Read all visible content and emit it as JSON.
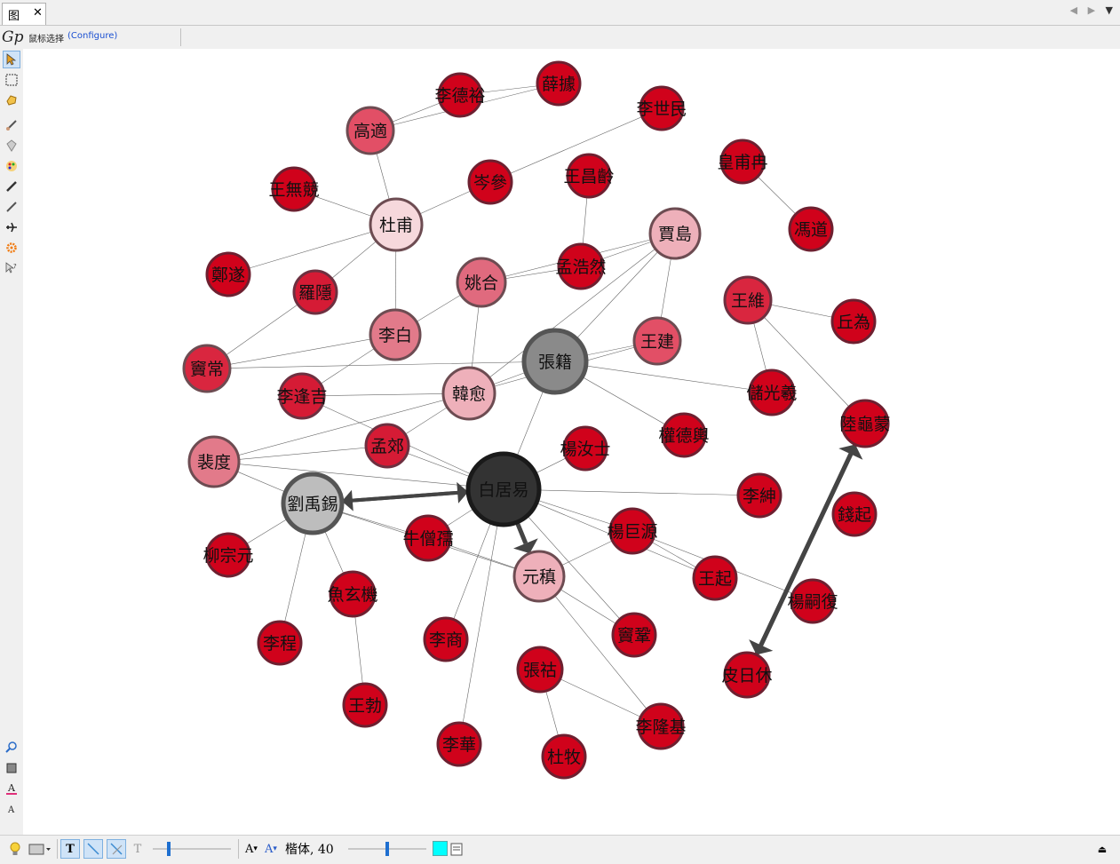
{
  "tab": {
    "label": "图",
    "close": "✕"
  },
  "toolbar": {
    "selection_label": "鼠标选择",
    "configure_link": "(Configure)"
  },
  "bottom": {
    "font_name": "楷体",
    "font_size": "40",
    "font_display": "楷体,  40"
  },
  "colors": {
    "accent_cyan": "#00ffff",
    "node_red": "#d0021b",
    "node_dark": "#333333",
    "node_grey": "#8a8a8a"
  },
  "graph": {
    "nodes": [
      {
        "id": "libai_r",
        "label": "白居易"
      },
      {
        "id": "zhangji",
        "label": "張籍"
      },
      {
        "id": "liuyuxi",
        "label": "劉禹錫"
      },
      {
        "id": "dufu",
        "label": "杜甫"
      },
      {
        "id": "jiadao",
        "label": "賈島"
      },
      {
        "id": "hanyu",
        "label": "韓愈"
      },
      {
        "id": "yuanzhen",
        "label": "元稹"
      },
      {
        "id": "libai",
        "label": "李白"
      },
      {
        "id": "peidu",
        "label": "裴度"
      },
      {
        "id": "yaohe",
        "label": "姚合"
      },
      {
        "id": "wangjian",
        "label": "王建"
      },
      {
        "id": "gaoshi",
        "label": "高適"
      },
      {
        "id": "doulchang",
        "label": "竇常"
      },
      {
        "id": "luoyin",
        "label": "羅隱"
      },
      {
        "id": "mengjiao",
        "label": "孟郊"
      },
      {
        "id": "lifengji",
        "label": "李逢吉"
      },
      {
        "id": "lideyu",
        "label": "李德裕"
      },
      {
        "id": "xueju",
        "label": "薛據"
      },
      {
        "id": "lishimin",
        "label": "李世民"
      },
      {
        "id": "censhen",
        "label": "岑參"
      },
      {
        "id": "wangchangling",
        "label": "王昌齡"
      },
      {
        "id": "huangfuran",
        "label": "皇甫冉"
      },
      {
        "id": "wangwuji",
        "label": "王無競"
      },
      {
        "id": "fengdao",
        "label": "馮道"
      },
      {
        "id": "zhengguo",
        "label": "鄭遂"
      },
      {
        "id": "menghaoran",
        "label": "孟浩然"
      },
      {
        "id": "wangwei",
        "label": "王維"
      },
      {
        "id": "qiuwei",
        "label": "丘為"
      },
      {
        "id": "chuguangxi",
        "label": "儲光羲"
      },
      {
        "id": "luguimeng",
        "label": "陸龜蒙"
      },
      {
        "id": "quandeyu",
        "label": "權德輿"
      },
      {
        "id": "yangruji",
        "label": "楊汝士"
      },
      {
        "id": "lishen",
        "label": "李紳"
      },
      {
        "id": "qianqi",
        "label": "錢起"
      },
      {
        "id": "liuzongyuan",
        "label": "柳宗元"
      },
      {
        "id": "niusengru",
        "label": "牛僧孺"
      },
      {
        "id": "yangjuyuan",
        "label": "楊巨源"
      },
      {
        "id": "wangqi",
        "label": "王起"
      },
      {
        "id": "yangsifu",
        "label": "楊嗣復"
      },
      {
        "id": "yuxuanji",
        "label": "魚玄機"
      },
      {
        "id": "licheng",
        "label": "李程"
      },
      {
        "id": "lishang",
        "label": "李商"
      },
      {
        "id": "doumou",
        "label": "竇鞏"
      },
      {
        "id": "pirixiu",
        "label": "皮日休"
      },
      {
        "id": "zhanghu",
        "label": "張祜"
      },
      {
        "id": "wangbo",
        "label": "王勃"
      },
      {
        "id": "lihua",
        "label": "李華"
      },
      {
        "id": "dumu",
        "label": "杜牧"
      },
      {
        "id": "lilongji",
        "label": "李隆基"
      }
    ]
  }
}
